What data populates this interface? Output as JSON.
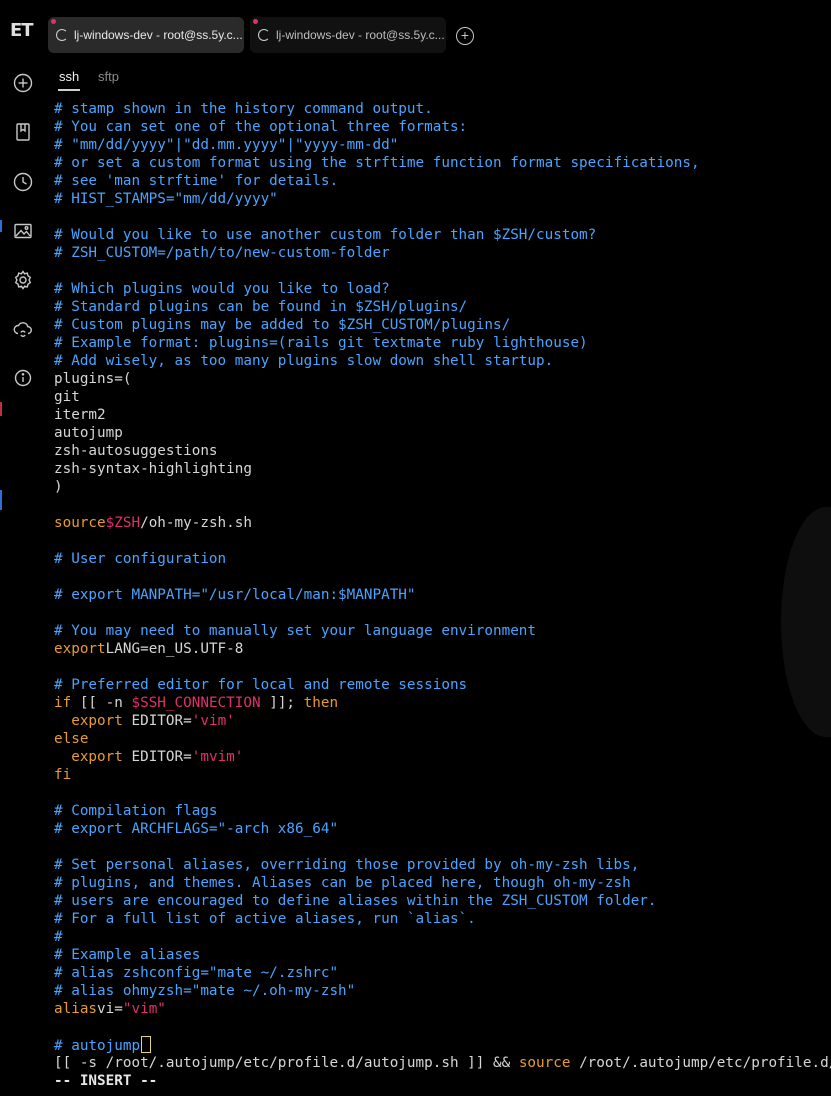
{
  "app": {
    "logo": "ET"
  },
  "tabs": [
    {
      "label": "lj-windows-dev - root@ss.5y.c...",
      "active": true
    },
    {
      "label": "lj-windows-dev - root@ss.5y.c...",
      "active": false
    }
  ],
  "subtabs": {
    "ssh": "ssh",
    "sftp": "sftp"
  },
  "sidebar_icons": [
    "plus-circle-icon",
    "bookmark-icon",
    "history-icon",
    "image-icon",
    "gear-icon",
    "cloud-sync-icon",
    "info-icon"
  ],
  "colors": {
    "comment": "#49a4ff",
    "keyword": "#e89c2c",
    "variable": "#e0306b",
    "text": "#d6d6d6"
  },
  "terminal": {
    "lines": [
      "# stamp shown in the history command output.",
      "# You can set one of the optional three formats:",
      "# \"mm/dd/yyyy\"|\"dd.mm.yyyy\"|\"yyyy-mm-dd\"",
      "# or set a custom format using the strftime function format specifications,",
      "# see 'man strftime' for details.",
      "# HIST_STAMPS=\"mm/dd/yyyy\"",
      "",
      "# Would you like to use another custom folder than $ZSH/custom?",
      "# ZSH_CUSTOM=/path/to/new-custom-folder",
      "",
      "# Which plugins would you like to load?",
      "# Standard plugins can be found in $ZSH/plugins/",
      "# Custom plugins may be added to $ZSH_CUSTOM/plugins/",
      "# Example format: plugins=(rails git textmate ruby lighthouse)",
      "# Add wisely, as too many plugins slow down shell startup.",
      "plugins=(",
      "git",
      "iterm2",
      "autojump",
      "zsh-autosuggestions",
      "zsh-syntax-highlighting",
      ")",
      "",
      "source|$ZSH|/oh-my-zsh.sh",
      "",
      "# User configuration",
      "",
      "# export MANPATH=\"/usr/local/man:$MANPATH\"",
      "",
      "# You may need to manually set your language environment",
      "export|LANG=en_US.UTF-8",
      "",
      "# Preferred editor for local and remote sessions",
      "if [[ -n |$SSH_CONNECTION| ]]; |then",
      "  |export| EDITOR=|'vim'",
      "else",
      "  |export| EDITOR=|'mvim'",
      "fi",
      "",
      "# Compilation flags",
      "# export ARCHFLAGS=\"-arch x86_64\"",
      "",
      "# Set personal aliases, overriding those provided by oh-my-zsh libs,",
      "# plugins, and themes. Aliases can be placed here, though oh-my-zsh",
      "# users are encouraged to define aliases within the ZSH_CUSTOM folder.",
      "# For a full list of active aliases, run `alias`.",
      "#",
      "# Example aliases",
      "# alias zshconfig=\"mate ~/.zshrc\"",
      "# alias ohmyzsh=\"mate ~/.oh-my-zsh\"",
      "alias|vi=|\"vim\"",
      "",
      "# autojump",
      "[[ -s /root/.autojump/etc/profile.d/autojump.sh ]] && |source| /root/.autojump/etc/profile.d/autojump.sh",
      "-- INSERT --"
    ]
  }
}
